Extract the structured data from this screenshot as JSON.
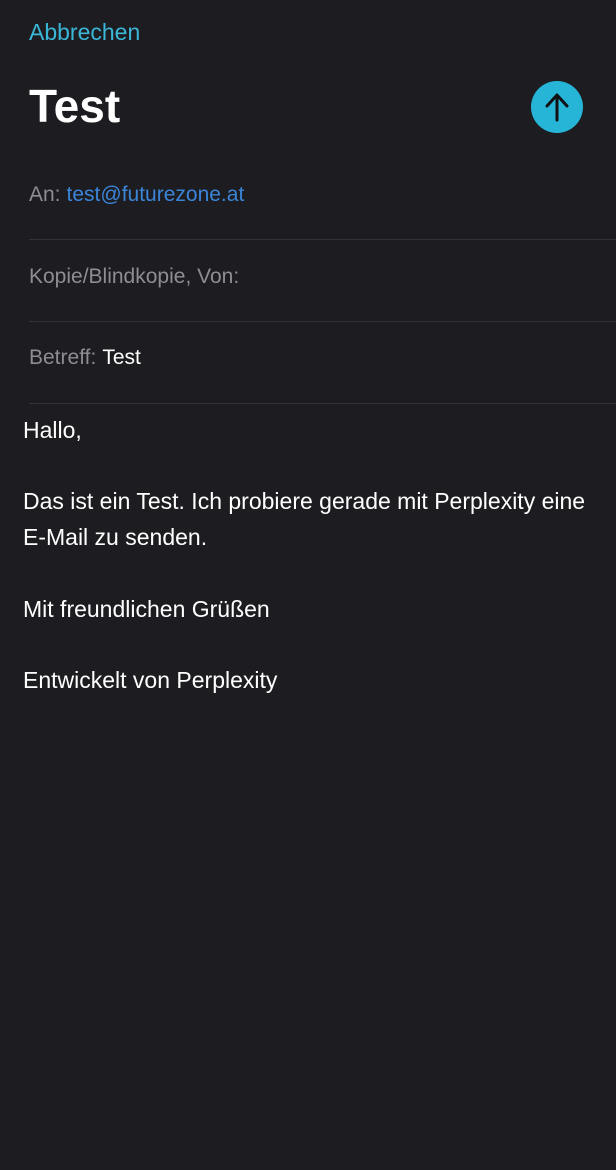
{
  "header": {
    "cancel_label": "Abbrechen",
    "subject_title": "Test",
    "send_icon": "arrow-up-icon",
    "accent_color": "#26b5d6"
  },
  "fields": {
    "to_label": "An:",
    "to_value": "test@futurezone.at",
    "cc_label": "Kopie/Blindkopie, Von:",
    "subject_label": "Betreff:",
    "subject_value": "Test"
  },
  "message": {
    "greeting": "Hallo,",
    "paragraph": "Das ist ein Test. Ich probiere gerade mit Perplexity eine E-Mail zu senden.",
    "closing": "Mit freundlichen Grüßen",
    "signature": "Entwickelt von Perplexity"
  }
}
